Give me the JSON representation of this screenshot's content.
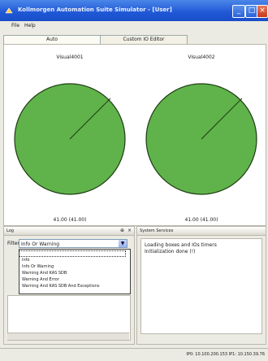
{
  "window": {
    "title": "Kollmorgen Automation Suite Simulator - [User]",
    "minimize": "_",
    "maximize": "□",
    "close": "×"
  },
  "menu": [
    "File",
    "Help"
  ],
  "tabs": [
    {
      "label": "Auto",
      "active": true
    },
    {
      "label": "Custom IO Editor",
      "active": false
    }
  ],
  "gauges": [
    {
      "title": "Visual4001",
      "readout": "41.00 (41.00)"
    },
    {
      "title": "Visual4002",
      "readout": "41.00 (41.00)"
    }
  ],
  "gauge_style": {
    "fill": "#5fb34a",
    "stroke": "#1f3d14"
  },
  "log_panel": {
    "title": "Log",
    "filter_label": "Filter",
    "filter_value": "Info Or Warning",
    "options": [
      "",
      "Info",
      "Info Or Warning",
      "Warning And KAS SDB",
      "Warning And Error",
      "Warning And KAS SDB And Exceptions"
    ]
  },
  "system_panel": {
    "title": "System Services",
    "lines": [
      "Loading boxes and IOs timers",
      "Initialization done (!)"
    ]
  },
  "status": {
    "text": "IP0: 10.100.200.153 IP1: 10.150.39.76"
  }
}
